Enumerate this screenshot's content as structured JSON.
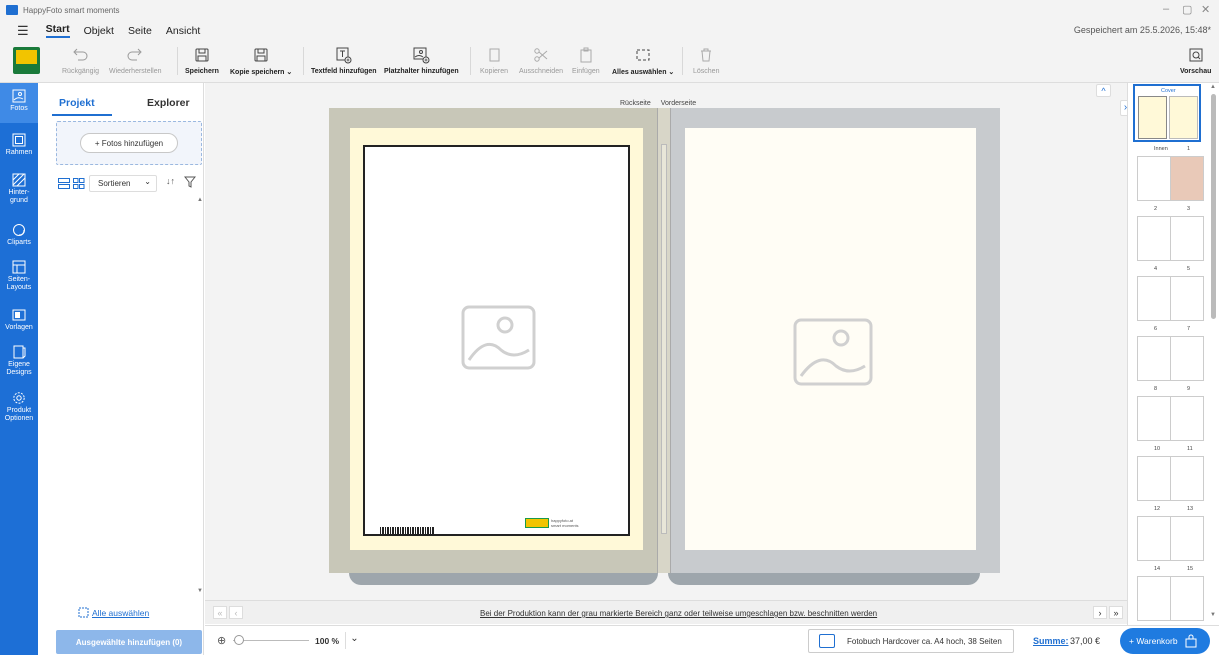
{
  "title_bar": {
    "app_title": "HappyFoto smart moments"
  },
  "menu": {
    "items": [
      "Start",
      "Objekt",
      "Seite",
      "Ansicht"
    ],
    "active": "Start",
    "saved_status": "Gespeichert am 25.5.2026, 15:48*"
  },
  "toolbar": {
    "undo": "Rückgängig",
    "redo": "Wiederherstellen",
    "save": "Speichern",
    "save_copy": "Kopie speichern ⌄",
    "add_text": "Textfeld hinzufügen",
    "add_placeholder": "Platzhalter hinzufügen",
    "copy": "Kopieren",
    "cut": "Ausschneiden",
    "paste": "Einfügen",
    "select_all": "Alles auswählen ⌄",
    "delete": "Löschen",
    "preview": "Vorschau"
  },
  "rail": {
    "items": [
      {
        "label": "Fotos",
        "icon": "photo-icon"
      },
      {
        "label": "Rahmen",
        "icon": "frame-icon"
      },
      {
        "label": "Hinter-\ngrund",
        "icon": "background-icon"
      },
      {
        "label": "Cliparts",
        "icon": "clipart-icon"
      },
      {
        "label": "Seiten-\nLayouts",
        "icon": "layout-icon"
      },
      {
        "label": "Vorlagen",
        "icon": "template-icon"
      },
      {
        "label": "Eigene\nDesigns",
        "icon": "design-icon"
      },
      {
        "label": "Produkt\nOptionen",
        "icon": "settings-icon"
      }
    ]
  },
  "panel": {
    "tab_project": "Projekt",
    "tab_explorer": "Explorer",
    "add_photos": "+ Fotos hinzufügen",
    "sort": "Sortieren",
    "select_all": "Alle auswählen",
    "add_selected": "Ausgewählte hinzufügen (0)"
  },
  "canvas": {
    "label_back": "Rückseite",
    "label_front": "Vorderseite",
    "notice": "Bei der Produktion kann der grau markierte Bereich ganz oder teilweise umgeschlagen bzw. beschnitten werden",
    "logo_text_1": "happyfoto.at",
    "logo_text_2": "smart moments"
  },
  "statusbar": {
    "zoom": "100 %",
    "product": "Fotobuch Hardcover ca. A4 hoch, 38 Seiten",
    "sum_label": "Summe:",
    "sum_value": "37,00 €",
    "cart": "+ Warenkorb"
  },
  "thumbnails": {
    "cover": "Cover",
    "rows": [
      [
        "Innen",
        "1"
      ],
      [
        "2",
        "3"
      ],
      [
        "4",
        "5"
      ],
      [
        "6",
        "7"
      ],
      [
        "8",
        "9"
      ],
      [
        "10",
        "11"
      ],
      [
        "12",
        "13"
      ],
      [
        "14",
        "15"
      ]
    ]
  },
  "colors": {
    "accent": "#1f6fd1",
    "rail": "#1d6fd6",
    "cover_left": "#c8c7b8",
    "cover_right": "#c8cbce"
  }
}
